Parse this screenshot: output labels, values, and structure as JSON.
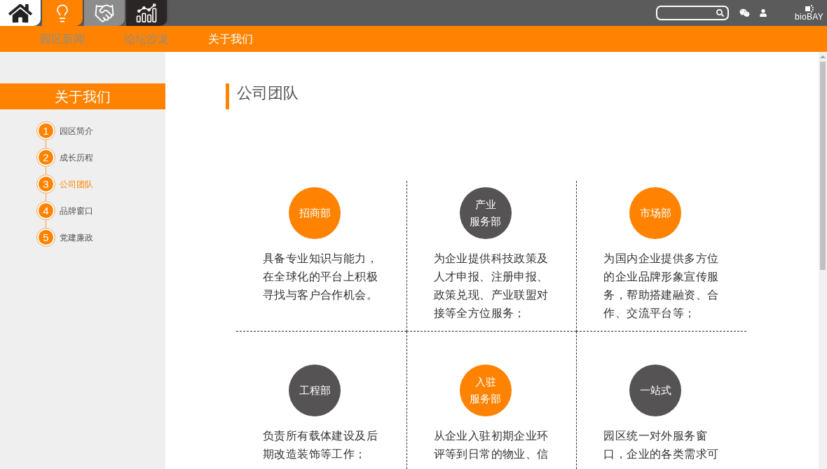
{
  "top_tabs": [
    {
      "kind": "home",
      "color": "#ffffff"
    },
    {
      "kind": "idea",
      "color": "#ff8300"
    },
    {
      "kind": "handshake",
      "color": "#8c8c8c"
    },
    {
      "kind": "chart",
      "color": "#2b2525"
    }
  ],
  "logo": {
    "text": "bioBAY"
  },
  "nav": {
    "items": [
      {
        "label": "园区新闻",
        "selected": false
      },
      {
        "label": "论坛沙龙",
        "selected": false
      },
      {
        "label": "关于我们",
        "selected": true
      }
    ]
  },
  "sidebar": {
    "title": "关于我们",
    "steps": [
      {
        "number": "1",
        "label": "园区简介",
        "selected": false
      },
      {
        "number": "2",
        "label": "成长历程",
        "selected": false
      },
      {
        "number": "3",
        "label": "公司团队",
        "selected": true
      },
      {
        "number": "4",
        "label": "品牌窗口",
        "selected": false
      },
      {
        "number": "5",
        "label": "党建廉政",
        "selected": false
      }
    ]
  },
  "main": {
    "title": "公司团队",
    "departments": [
      {
        "name_lines": [
          "招商部"
        ],
        "color": "#ff8300",
        "description": [
          "具备专业知识与能力，",
          "在全球化的平台上积极",
          "寻找与客户合作机会。"
        ]
      },
      {
        "name_lines": [
          "产业",
          "服务部"
        ],
        "color": "#555353",
        "description": [
          "为企业提供科技政策及",
          "人才申报、注册申报、",
          "政策兑现、产业联盟对",
          "接等全方位服务；"
        ]
      },
      {
        "name_lines": [
          "市场部"
        ],
        "color": "#ff8300",
        "description": [
          "为国内企业提供多方位",
          "的企业品牌形象宣传服",
          "务，帮助搭建融资、合",
          "作、交流平台等；"
        ]
      },
      {
        "name_lines": [
          "工程部"
        ],
        "color": "#555353",
        "description": [
          "负责所有载体建设及后",
          "期改造装饰等工作；"
        ]
      },
      {
        "name_lines": [
          "入驻",
          "服务部"
        ],
        "color": "#ff8300",
        "description": [
          "从企业入驻初期企业环",
          "评等到日常的物业、信"
        ]
      },
      {
        "name_lines": [
          "一站式"
        ],
        "color": "#555353",
        "description": [
          "园区统一对外服务窗",
          "口，企业的各类需求可"
        ]
      }
    ]
  }
}
